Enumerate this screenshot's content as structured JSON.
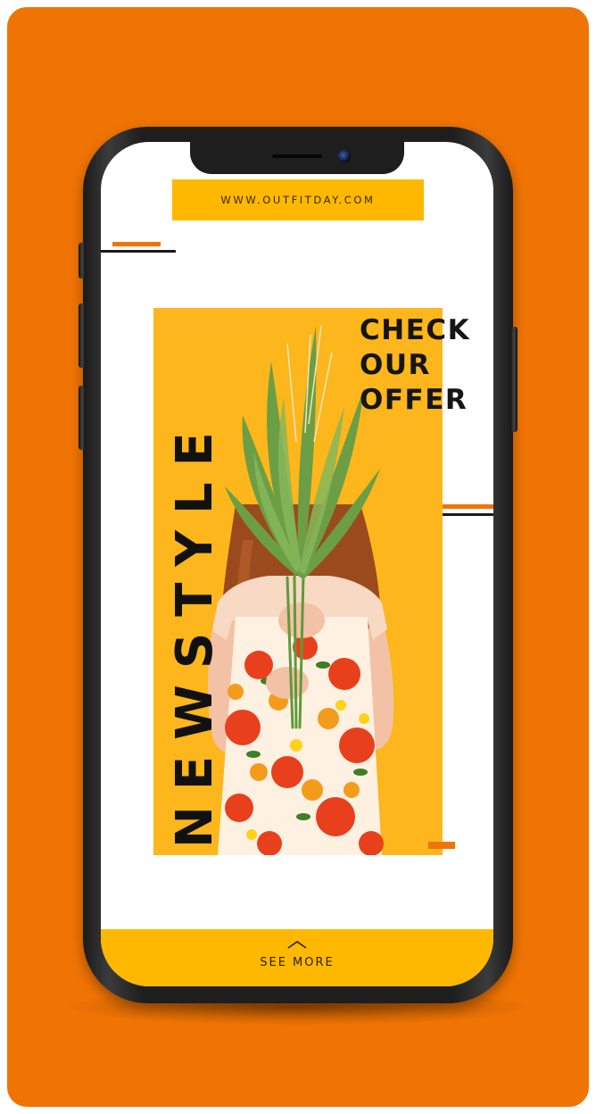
{
  "colors": {
    "background_orange": "#f07404",
    "accent_yellow": "#ffb800",
    "promo_yellow": "#fdb61b",
    "text_dark": "#111111"
  },
  "header": {
    "url": "WWW.OUTFITDAY.COM"
  },
  "promo": {
    "vertical_title": "NEWSTYLE",
    "offer_lines": [
      "CHECK",
      "OUR",
      "OFFER"
    ],
    "image": "woman-holding-grass-bouquet"
  },
  "footer": {
    "icon": "chevron-up-icon",
    "label": "SEE MORE"
  }
}
